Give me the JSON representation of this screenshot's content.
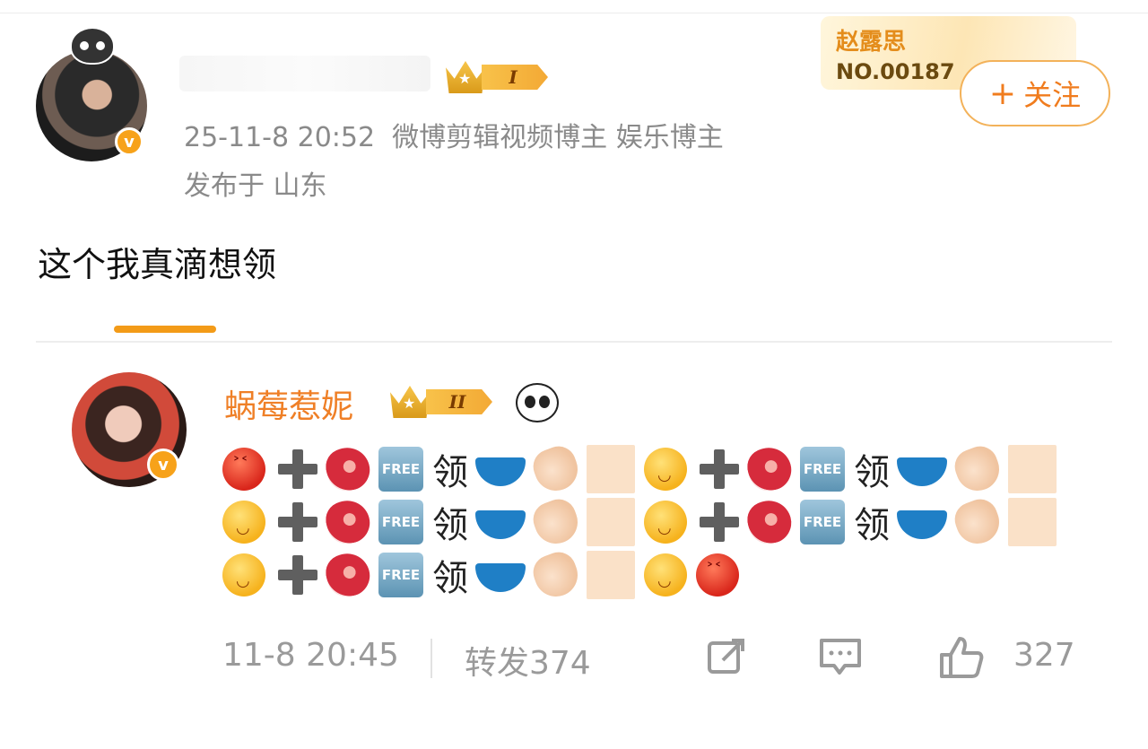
{
  "post": {
    "author_name_blurred": true,
    "rank_roman": "I",
    "timestamp": "25-11-8 20:52",
    "tags": "微博剪辑视频博主 娱乐博主",
    "location": "发布于 山东",
    "text": "这个我真滴想领",
    "fan_card": {
      "name": "赵露思",
      "number": "NO.00187"
    },
    "follow_label": "关注",
    "follow_plus": "+"
  },
  "comment": {
    "author": "蜗莓惹妮",
    "rank_roman": "II",
    "verified_badge": "v",
    "emoji_sequence_text": "领",
    "free_label": "FREE",
    "rows": [
      [
        "angry",
        "plus",
        "meat",
        "free",
        "ling",
        "briefs",
        "clap",
        "box",
        "wink",
        "plus",
        "meat",
        "free",
        "ling",
        "briefs",
        "clap",
        "box"
      ],
      [
        "wink",
        "plus",
        "meat",
        "free",
        "ling",
        "briefs",
        "clap",
        "box",
        "wink",
        "plus",
        "meat",
        "free",
        "ling",
        "briefs",
        "clap",
        "box"
      ],
      [
        "wink",
        "plus",
        "meat",
        "free",
        "ling",
        "briefs",
        "clap",
        "box",
        "wink",
        "angry"
      ]
    ],
    "footer": {
      "time": "11-8 20:45",
      "repost_label": "转发374",
      "like_count": "327"
    }
  },
  "colors": {
    "accent": "#f07c1e",
    "name": "#ef7f26",
    "meta": "#8a8a8a",
    "tab": "#f39b18"
  }
}
